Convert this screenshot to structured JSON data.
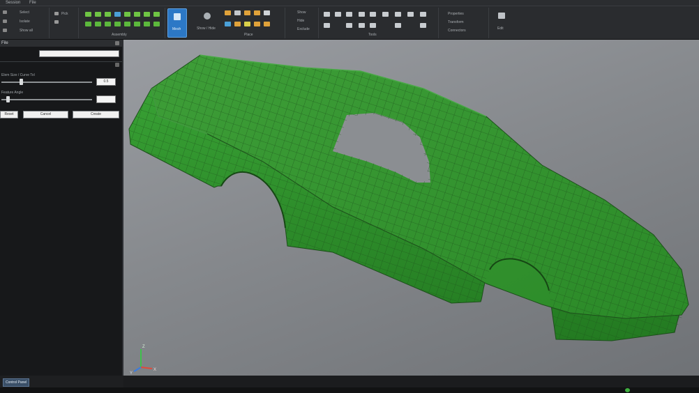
{
  "menubar": {
    "items": [
      "Session",
      "File"
    ]
  },
  "ribbon": {
    "groups": [
      {
        "label": "Assembly"
      },
      {
        "label": "Place"
      },
      {
        "label": "Tools"
      },
      {
        "label": "Edit"
      }
    ],
    "mesh_button": {
      "label": "Mesh"
    },
    "ghost_button": {
      "label": "Show / Hide"
    },
    "small_labels": [
      "Select",
      "Isolate",
      "Show all",
      "Pick",
      "Show",
      "Hide",
      "Exclude",
      "Properties",
      "Transform",
      "Connectors"
    ],
    "colors": {
      "bg": "#2a2c2f",
      "accent_mesh": "#2c78c6",
      "icon_green": "#7bcf47",
      "icon_orange": "#e0a23a"
    }
  },
  "panel": {
    "title": "File",
    "slider1": {
      "label": "Elem Size / Curve Tol",
      "value": "0.5",
      "fraction": 0.2
    },
    "slider2": {
      "label": "Feature Angle",
      "value": "",
      "fraction": 0.05
    },
    "buttons": [
      "Reset",
      "Cancel",
      "Create"
    ]
  },
  "viewport": {
    "colors": {
      "model": "#2f8f2b",
      "model_light": "#4cc34a",
      "mesh_line": "#1f5a1d"
    }
  },
  "bottom_tabs": {
    "active": "Control Panel"
  },
  "triad": {
    "x": "X",
    "y": "Y",
    "z": "Z"
  }
}
